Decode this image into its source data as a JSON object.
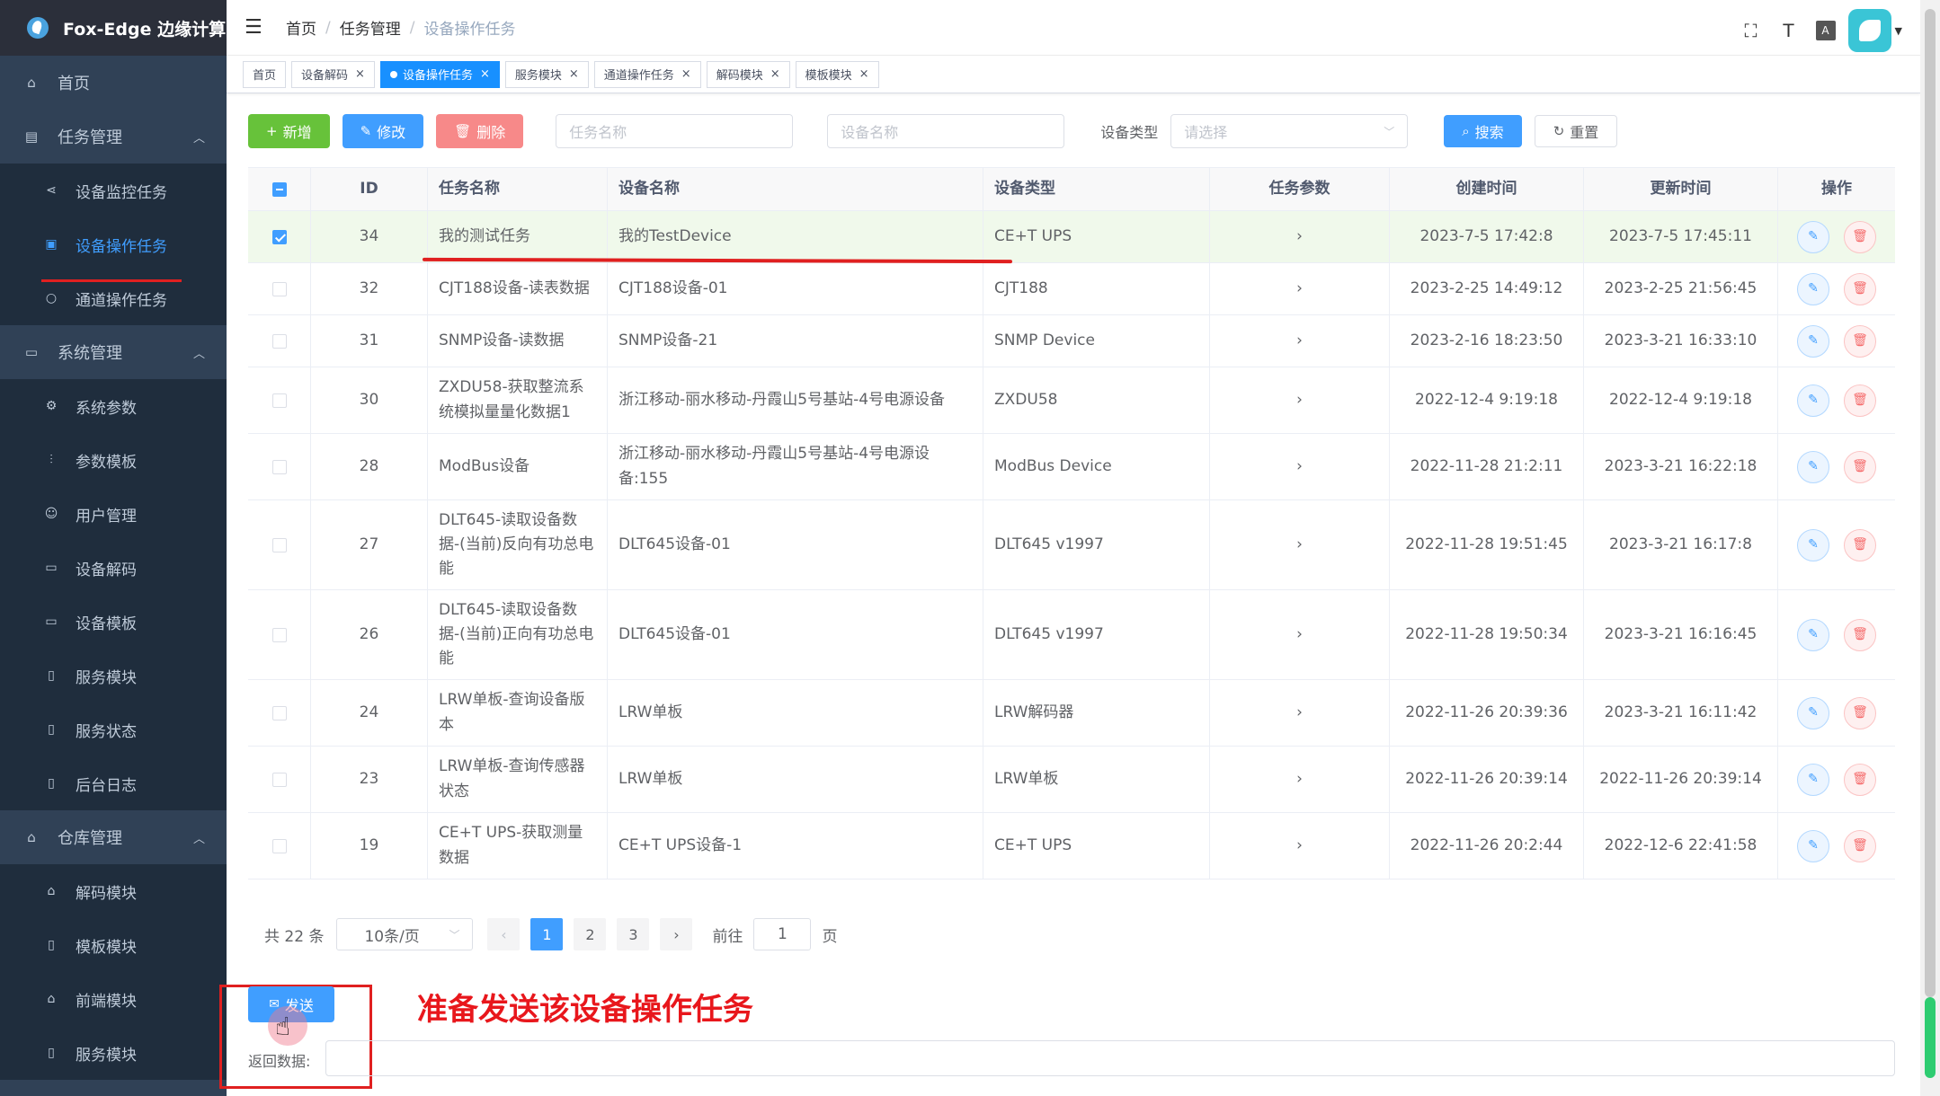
{
  "app": {
    "title": "Fox-Edge 边缘计算"
  },
  "sidebar": {
    "items": [
      {
        "label": "首页",
        "icon": "home-icon"
      },
      {
        "label": "任务管理",
        "icon": "dashboard-icon",
        "expanded": true,
        "children": [
          {
            "label": "设备监控任务",
            "icon": "share-icon"
          },
          {
            "label": "设备操作任务",
            "icon": "list-icon",
            "active": true
          },
          {
            "label": "通道操作任务",
            "icon": "circle-icon"
          }
        ]
      },
      {
        "label": "系统管理",
        "icon": "monitor-icon",
        "expanded": true,
        "children": [
          {
            "label": "系统参数",
            "icon": "gear-icon"
          },
          {
            "label": "参数模板",
            "icon": "sliders-icon"
          },
          {
            "label": "用户管理",
            "icon": "user-icon"
          },
          {
            "label": "设备解码",
            "icon": "card-icon"
          },
          {
            "label": "设备模板",
            "icon": "card-icon"
          },
          {
            "label": "服务模块",
            "icon": "doc-icon"
          },
          {
            "label": "服务状态",
            "icon": "doc-icon"
          },
          {
            "label": "后台日志",
            "icon": "doc-icon"
          }
        ]
      },
      {
        "label": "仓库管理",
        "icon": "warehouse-icon",
        "expanded": true,
        "children": [
          {
            "label": "解码模块",
            "icon": "warehouse-icon"
          },
          {
            "label": "模板模块",
            "icon": "doc-icon"
          },
          {
            "label": "前端模块",
            "icon": "warehouse-icon"
          },
          {
            "label": "服务模块",
            "icon": "doc-icon"
          }
        ]
      }
    ]
  },
  "header": {
    "breadcrumb": [
      "首页",
      "任务管理",
      "设备操作任务"
    ],
    "tools": [
      "fullscreen-icon",
      "font-size-icon",
      "translate-icon"
    ]
  },
  "tags": [
    {
      "label": "首页",
      "closable": false
    },
    {
      "label": "设备解码",
      "closable": true
    },
    {
      "label": "设备操作任务",
      "closable": true,
      "active": true
    },
    {
      "label": "服务模块",
      "closable": true
    },
    {
      "label": "通道操作任务",
      "closable": true
    },
    {
      "label": "解码模块",
      "closable": true
    },
    {
      "label": "模板模块",
      "closable": true
    }
  ],
  "toolbar": {
    "add_label": "新增",
    "edit_label": "修改",
    "delete_label": "删除",
    "task_name_placeholder": "任务名称",
    "device_name_placeholder": "设备名称",
    "device_type_label": "设备类型",
    "device_type_placeholder": "请选择",
    "search_label": "搜索",
    "reset_label": "重置"
  },
  "table": {
    "columns": [
      "ID",
      "任务名称",
      "设备名称",
      "设备类型",
      "任务参数",
      "创建时间",
      "更新时间",
      "操作"
    ],
    "param_glyph": "›",
    "rows": [
      {
        "id": "34",
        "task": "我的测试任务",
        "device": "我的TestDevice",
        "type": "CE+T UPS",
        "created": "2023-7-5 17:42:8",
        "updated": "2023-7-5 17:45:11",
        "selected": true
      },
      {
        "id": "32",
        "task": "CJT188设备-读表数据",
        "device": "CJT188设备-01",
        "type": "CJT188",
        "created": "2023-2-25 14:49:12",
        "updated": "2023-2-25 21:56:45"
      },
      {
        "id": "31",
        "task": "SNMP设备-读数据",
        "device": "SNMP设备-21",
        "type": "SNMP Device",
        "created": "2023-2-16 18:23:50",
        "updated": "2023-3-21 16:33:10"
      },
      {
        "id": "30",
        "task": "ZXDU58-获取整流系统模拟量量化数据1",
        "device": "浙江移动-丽水移动-丹霞山5号基站-4号电源设备",
        "type": "ZXDU58",
        "created": "2022-12-4 9:19:18",
        "updated": "2022-12-4 9:19:18"
      },
      {
        "id": "28",
        "task": "ModBus设备",
        "device": "浙江移动-丽水移动-丹霞山5号基站-4号电源设备:155",
        "type": "ModBus Device",
        "created": "2022-11-28 21:2:11",
        "updated": "2023-3-21 16:22:18"
      },
      {
        "id": "27",
        "task": "DLT645-读取设备数据-(当前)反向有功总电能",
        "device": "DLT645设备-01",
        "type": "DLT645 v1997",
        "created": "2022-11-28 19:51:45",
        "updated": "2023-3-21 16:17:8"
      },
      {
        "id": "26",
        "task": "DLT645-读取设备数据-(当前)正向有功总电能",
        "device": "DLT645设备-01",
        "type": "DLT645 v1997",
        "created": "2022-11-28 19:50:34",
        "updated": "2023-3-21 16:16:45"
      },
      {
        "id": "24",
        "task": "LRW单板-查询设备版本",
        "device": "LRW单板",
        "type": "LRW解码器",
        "created": "2022-11-26 20:39:36",
        "updated": "2023-3-21 16:11:42"
      },
      {
        "id": "23",
        "task": "LRW单板-查询传感器状态",
        "device": "LRW单板",
        "type": "LRW单板",
        "created": "2022-11-26 20:39:14",
        "updated": "2022-11-26 20:39:14"
      },
      {
        "id": "19",
        "task": "CE+T UPS-获取测量数据",
        "device": "CE+T UPS设备-1",
        "type": "CE+T UPS",
        "created": "2022-11-26 20:2:44",
        "updated": "2022-12-6 22:41:58"
      }
    ]
  },
  "pagination": {
    "total_text": "共 22 条",
    "page_size": "10条/页",
    "pages": [
      "1",
      "2",
      "3"
    ],
    "current_page": "1",
    "goto_label": "前往",
    "goto_value": "1",
    "page_suffix": "页"
  },
  "send": {
    "label": "发送",
    "return_label": "返回数据:"
  },
  "annotation": {
    "text": "准备发送该设备操作任务"
  },
  "colors": {
    "sidebar_bg": "#304156",
    "primary": "#409eff",
    "success": "#67c23a",
    "danger": "#f56c6c",
    "annotation": "#e02020"
  }
}
